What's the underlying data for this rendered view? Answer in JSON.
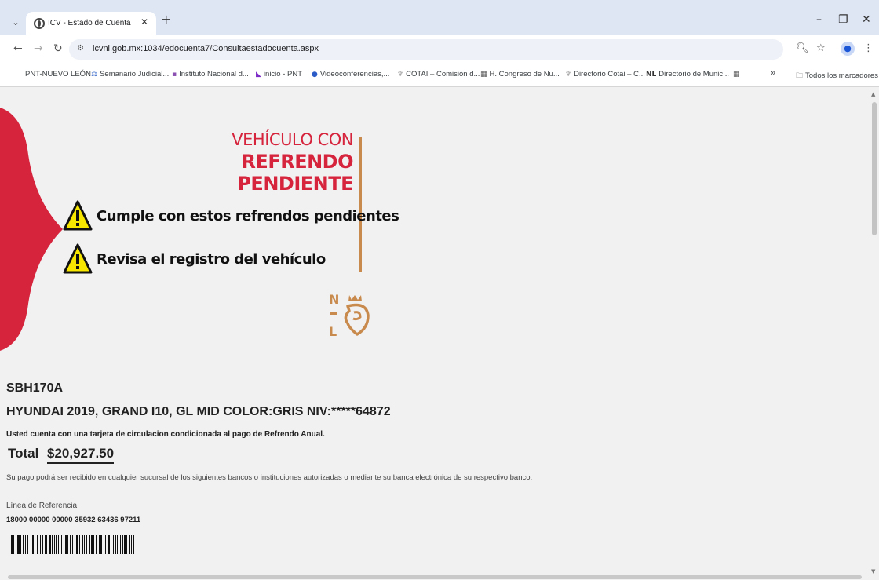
{
  "browser": {
    "tab": {
      "title": "ICV - Estado de Cuenta"
    },
    "url": "icvnl.gob.mx:1034/edocuenta7/Consultaestadocuenta.aspx",
    "bookmarks": [
      {
        "label": "PNT-NUEVO LEÓN",
        "icon": ""
      },
      {
        "label": "Semanario Judicial...",
        "icon": "scale-icon"
      },
      {
        "label": "Instituto Nacional d...",
        "icon": "inai-icon"
      },
      {
        "label": "inicio - PNT",
        "icon": "pnt-icon"
      },
      {
        "label": "Videoconferencias,...",
        "icon": "video-icon"
      },
      {
        "label": "COTAI – Comisión d...",
        "icon": "cotai-icon"
      },
      {
        "label": "H. Congreso de Nu...",
        "icon": "congress-icon"
      },
      {
        "label": "Directorio Cotai – C...",
        "icon": "cotai-icon"
      },
      {
        "label": "Directorio de Munic...",
        "icon": "nl-icon"
      }
    ],
    "bookmarks_overflow": "»",
    "all_bookmarks": "Todos los marcadores"
  },
  "banner": {
    "line1": "VEHÍCULO CON",
    "line2": "REFRENDO",
    "line3": "PENDIENTE",
    "warning1": "Cumple con estos refrendos pendientes",
    "warning2": "Revisa el registro del vehículo",
    "logo_letters": {
      "n": "N",
      "l": "L"
    }
  },
  "account": {
    "plate": "SBH170A",
    "vehicle": "HYUNDAI 2019, GRAND I10, GL MID COLOR:GRIS NIV:*****64872",
    "notice": "Usted cuenta con una tarjeta de circulacion condicionada al pago de Refrendo Anual.",
    "total_label": "Total",
    "total_amount": "$20,927.50",
    "payment_text": "Su pago podrá ser recibido en cualquier sucursal de los siguientes bancos o instituciones autorizadas o mediante su banca electrónica de su respectivo banco.",
    "reference_label": "Línea de Referencia",
    "reference_number": "18000 00000 00000 35932 63436 97211"
  },
  "colors": {
    "brand_red": "#d6243d",
    "brand_orange": "#c98a4d",
    "warning_yellow": "#f7e600"
  }
}
